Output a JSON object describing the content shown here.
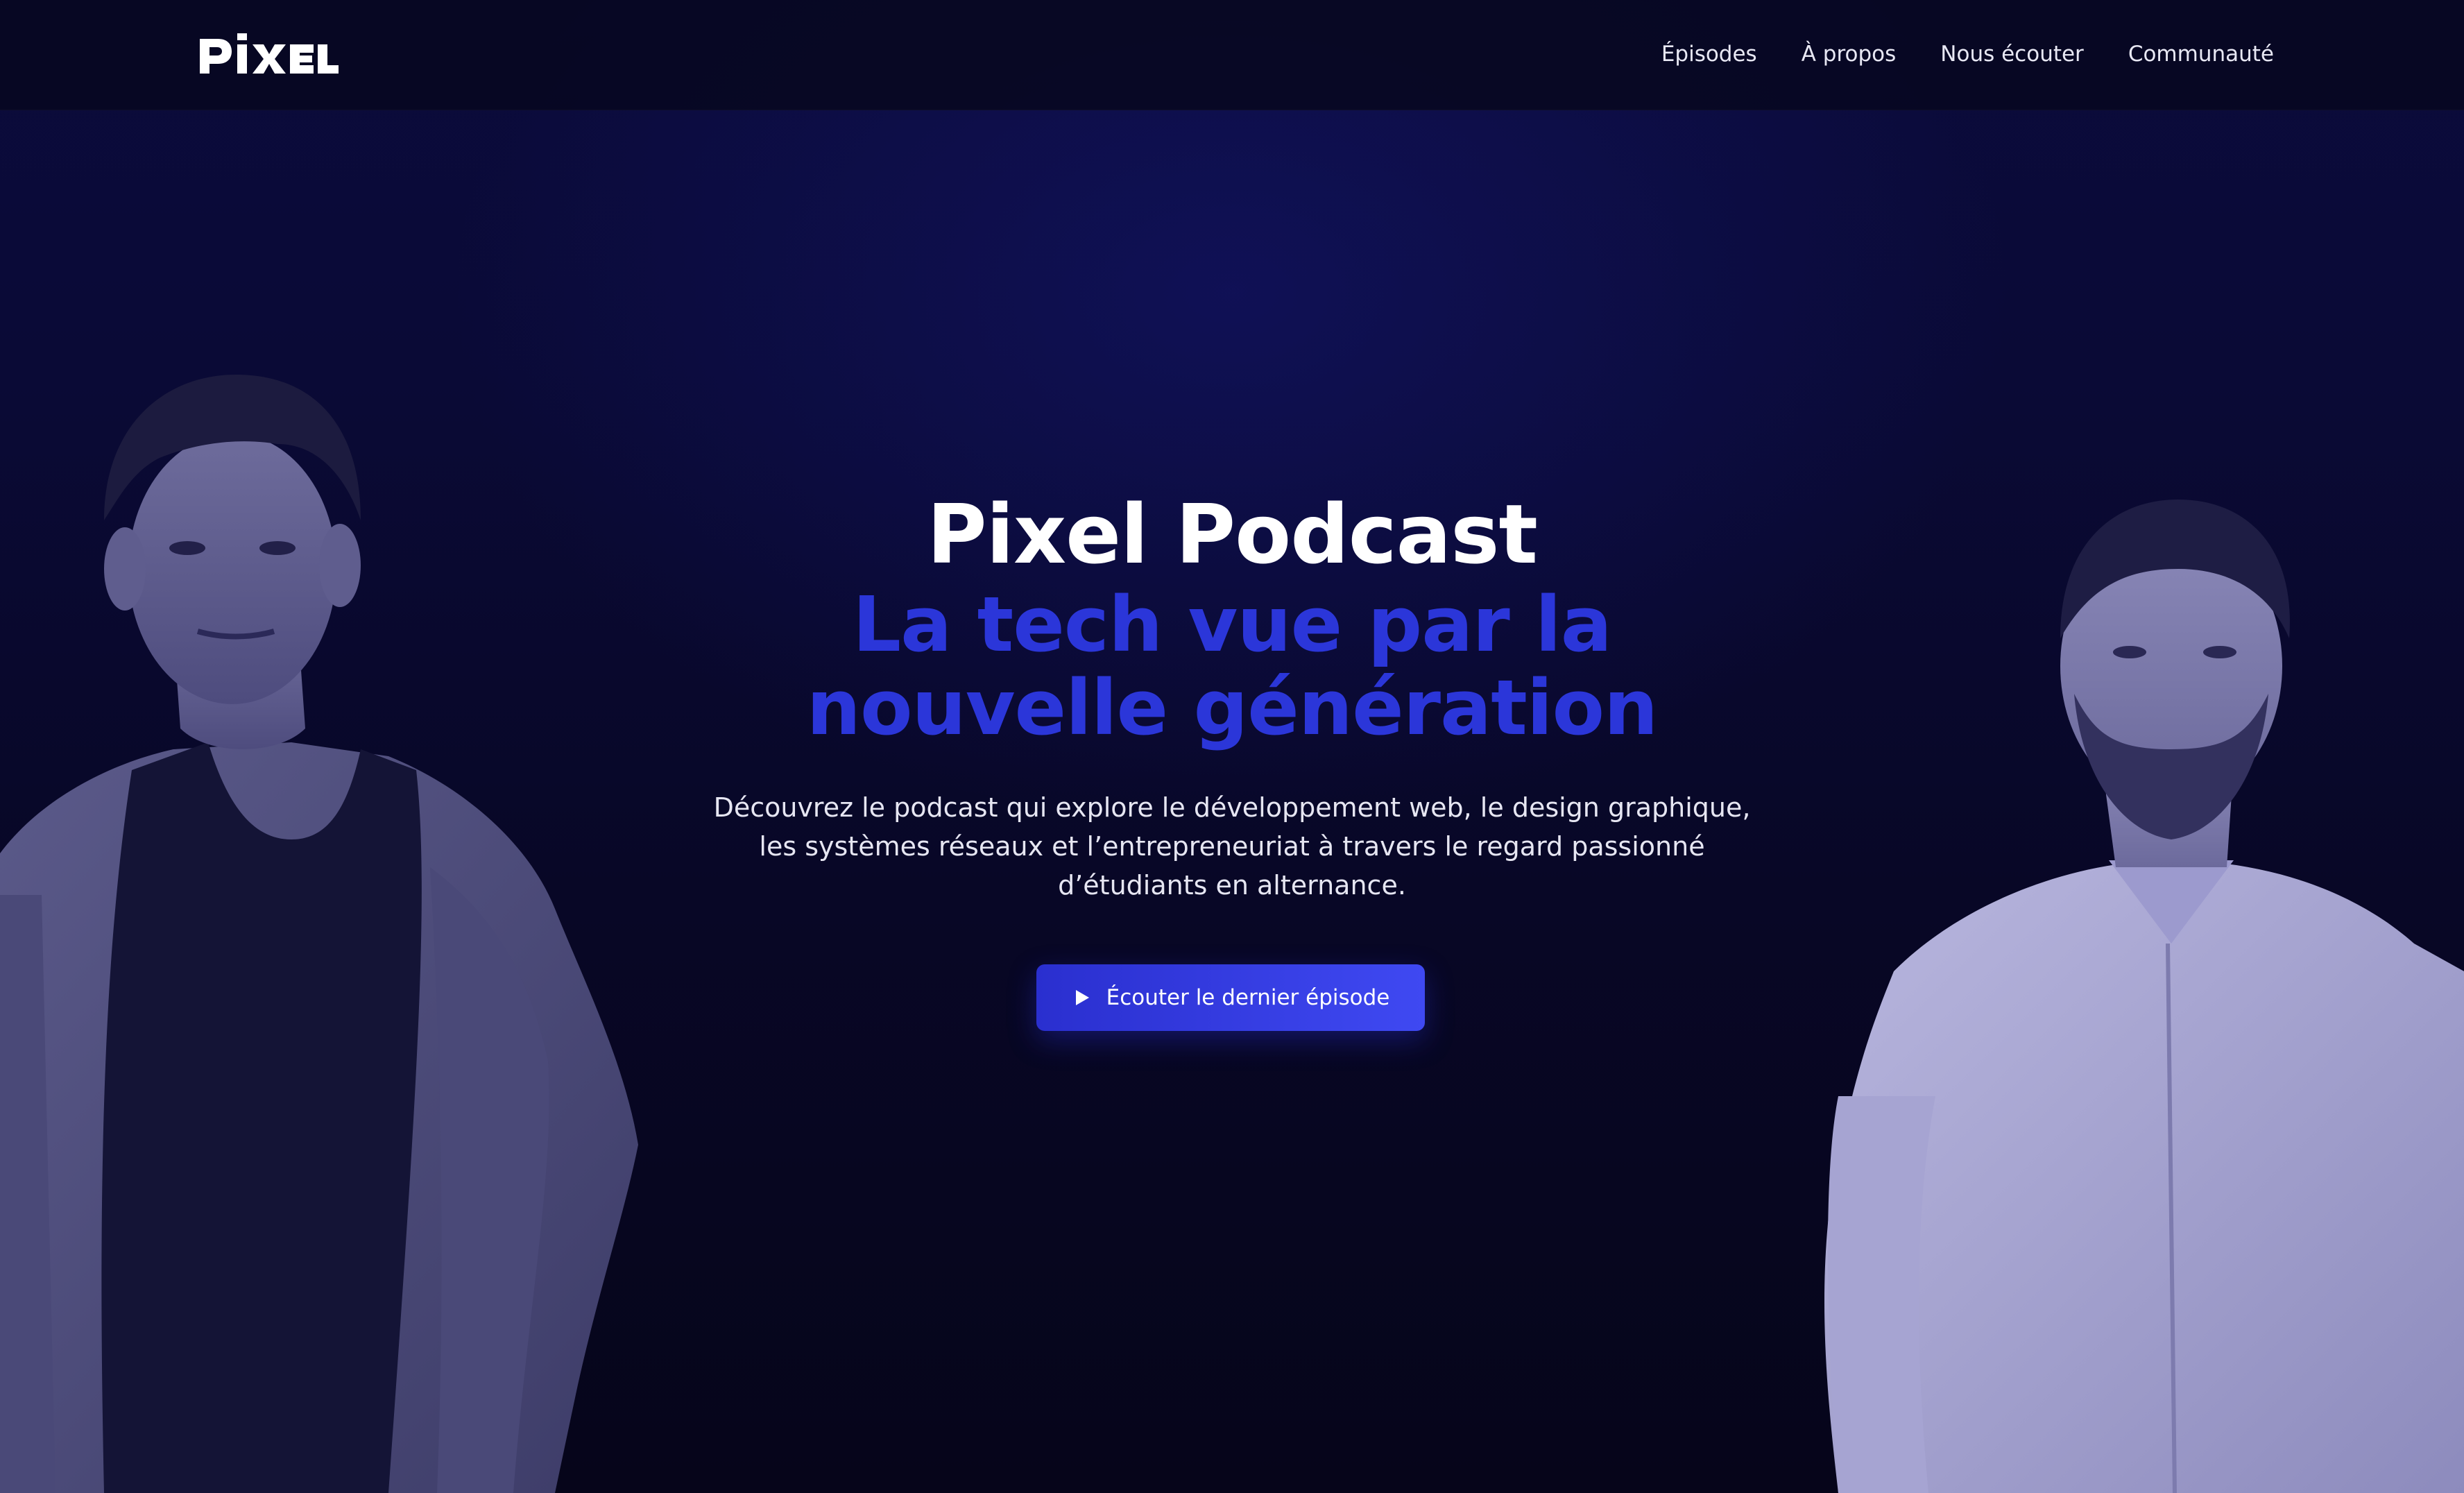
{
  "nav": {
    "logo_text": "PIXEL",
    "links": [
      {
        "label": "Épisodes"
      },
      {
        "label": "À propos"
      },
      {
        "label": "Nous écouter"
      },
      {
        "label": "Communauté"
      }
    ]
  },
  "hero": {
    "title": "Pixel Podcast",
    "subtitle": "La tech vue par la nouvelle génération",
    "description": "Découvrez le podcast qui explore le développement web, le design graphique, les systèmes réseaux et l’entrepreneuriat à travers le regard passionné d’étudiants en alternance.",
    "cta_label": "Écouter le dernier épisode"
  },
  "colors": {
    "background": "#07061c",
    "accent": "#2b36d9",
    "button": "#3340e8",
    "text": "#ffffff"
  },
  "icons": {
    "cta_icon": "play-icon"
  }
}
